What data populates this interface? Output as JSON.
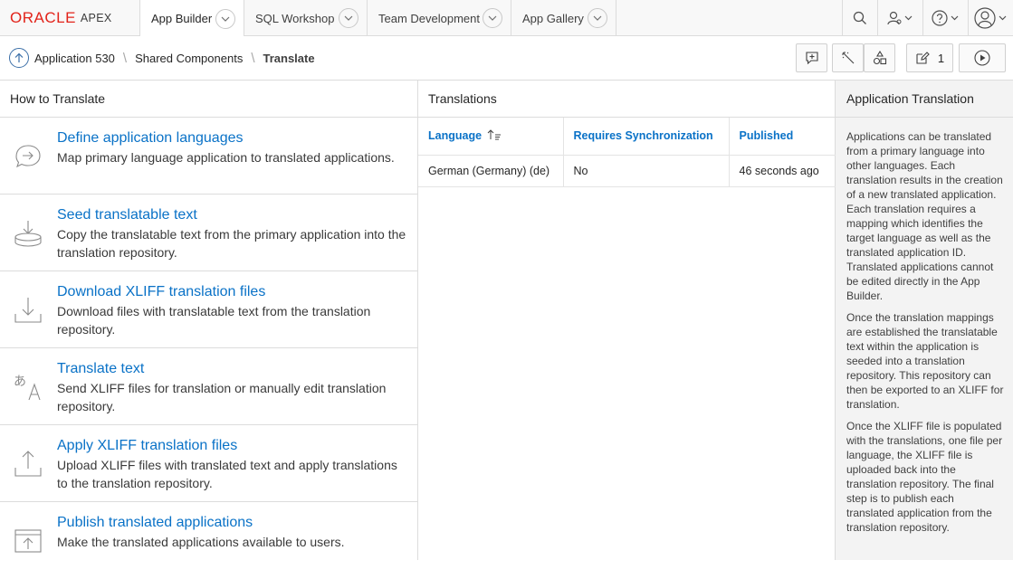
{
  "logo": {
    "oracle": "ORACLE",
    "apex": "APEX"
  },
  "tabs": [
    {
      "label": "App Builder"
    },
    {
      "label": "SQL Workshop"
    },
    {
      "label": "Team Development"
    },
    {
      "label": "App Gallery"
    }
  ],
  "breadcrumb": {
    "items": [
      "Application 530",
      "Shared Components",
      "Translate"
    ]
  },
  "toolbar": {
    "edit_count": "1"
  },
  "left": {
    "title": "How to Translate",
    "steps": [
      {
        "title": "Define application languages",
        "desc": "Map primary language application to translated applications."
      },
      {
        "title": "Seed translatable text",
        "desc": "Copy the translatable text from the primary application into the translation repository."
      },
      {
        "title": "Download XLIFF translation files",
        "desc": "Download files with translatable text from the translation repository."
      },
      {
        "title": "Translate text",
        "desc": "Send XLIFF files for translation or manually edit translation repository."
      },
      {
        "title": "Apply XLIFF translation files",
        "desc": "Upload XLIFF files with translated text and apply translations to the translation repository."
      },
      {
        "title": "Publish translated applications",
        "desc": "Make the translated applications available to users."
      }
    ]
  },
  "mid": {
    "title": "Translations",
    "columns": [
      "Language",
      "Requires Synchronization",
      "Published"
    ],
    "rows": [
      [
        "German (Germany) (de)",
        "No",
        "46 seconds ago"
      ]
    ]
  },
  "right": {
    "title": "Application Translation",
    "paragraphs": [
      "Applications can be translated from a primary language into other languages. Each translation results in the creation of a new translated application. Each translation requires a mapping which identifies the target language as well as the translated application ID. Translated applications cannot be edited directly in the App Builder.",
      "Once the translation mappings are established the translatable text within the application is seeded into a translation repository. This repository can then be exported to an XLIFF for translation.",
      "Once the XLIFF file is populated with the translations, one file per language, the XLIFF file is uploaded back into the translation repository. The final step is to publish each translated application from the translation repository."
    ]
  },
  "colors": {
    "link": "#0a72c7",
    "oracle_red": "#e2231a"
  }
}
